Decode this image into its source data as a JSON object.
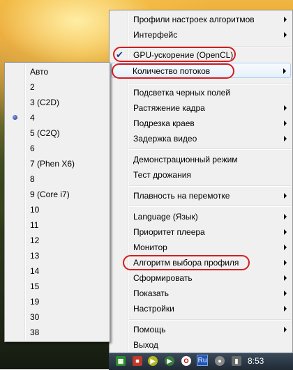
{
  "main_menu": {
    "items": [
      {
        "label": "Профили настроек алгоритмов",
        "submenu": true
      },
      {
        "label": "Интерфейс",
        "submenu": true
      },
      {
        "label": "GPU-ускорение (OpenCL)",
        "checked": true,
        "highlighted": true
      },
      {
        "label": "Количество потоков",
        "submenu": true,
        "highlighted": true,
        "hover": true
      },
      {
        "label": "Подсветка черных полей"
      },
      {
        "label": "Растяжение кадра",
        "submenu": true
      },
      {
        "label": "Подрезка краев",
        "submenu": true
      },
      {
        "label": "Задержка видео",
        "submenu": true
      },
      {
        "label": "Демонстрационный режим"
      },
      {
        "label": "Тест дрожания"
      },
      {
        "label": "Плавность на перемотке",
        "submenu": true
      },
      {
        "label": "Language (Язык)",
        "submenu": true
      },
      {
        "label": "Приоритет плеера",
        "submenu": true
      },
      {
        "label": "Монитор",
        "submenu": true
      },
      {
        "label": "Алгоритм выбора профиля",
        "submenu": true,
        "highlighted": true
      },
      {
        "label": "Сформировать",
        "submenu": true
      },
      {
        "label": "Показать",
        "submenu": true
      },
      {
        "label": "Настройки",
        "submenu": true
      },
      {
        "label": "Помощь",
        "submenu": true
      },
      {
        "label": "Выход"
      }
    ]
  },
  "threads_submenu": {
    "selected": "4",
    "items": [
      "Авто",
      "2",
      "3 (C2D)",
      "4",
      "5 (C2Q)",
      "6",
      "7 (Phen X6)",
      "8",
      "9 (Core i7)",
      "10",
      "11",
      "12",
      "13",
      "14",
      "15",
      "19",
      "30",
      "38"
    ]
  },
  "taskbar": {
    "language": "Ru",
    "clock": "8:53",
    "tray_icons": [
      "green-grid-icon",
      "red-app-icon",
      "play-icon",
      "media-icon",
      "opera-icon",
      "stop-icon",
      "network-icon",
      "green-circle-icon"
    ]
  },
  "colors": {
    "highlight_oval": "#d81c1c",
    "menu_bg": "#f0f0f0",
    "hover_border": "#aecff7"
  }
}
